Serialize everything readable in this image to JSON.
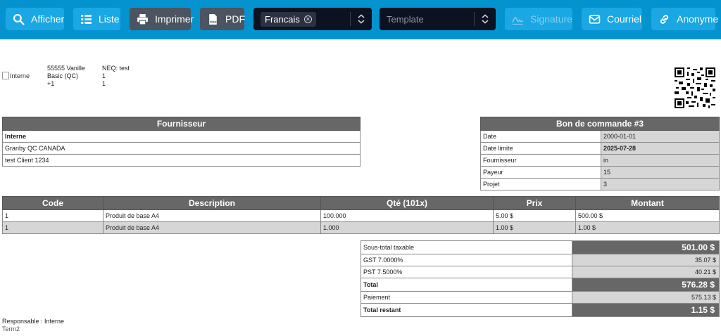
{
  "toolbar": {
    "afficher": "Afficher",
    "liste": "Liste",
    "imprimer": "Imprimer",
    "pdf": "PDF",
    "language_selected": "Francais",
    "template_placeholder": "Template",
    "signature": "Signature",
    "courriel": "Courriel",
    "anonyme": "Anonyme"
  },
  "company": {
    "logo_alt": "Interne",
    "address_line1": "55555 Vanille",
    "address_line2": "Basic (QC)",
    "address_line3": "+1",
    "neq": "NEQ: test",
    "val1": "1",
    "val2": "1"
  },
  "supplier": {
    "header": "Fournisseur",
    "name": "Interne",
    "address": "Granby QC CANADA",
    "client": "test Client 1234"
  },
  "order": {
    "header": "Bon de commande #3",
    "rows": [
      {
        "label": "Date",
        "value": "2000-01-01"
      },
      {
        "label": "Date limite",
        "value": "2025-07-28"
      },
      {
        "label": "Fournisseur",
        "value": "in"
      },
      {
        "label": "Payeur",
        "value": "15"
      },
      {
        "label": "Projet",
        "value": "3"
      }
    ]
  },
  "items": {
    "headers": {
      "code": "Code",
      "description": "Description",
      "qty": "Qté (101x)",
      "price": "Prix",
      "amount": "Montant"
    },
    "rows": [
      {
        "code": "1",
        "description": "Produit de base A4",
        "qty": "100.000",
        "price": "5.00 $",
        "amount": "500.00 $"
      },
      {
        "code": "1",
        "description": "Produit de base A4",
        "qty": "1.000",
        "price": "1.00 $",
        "amount": "1.00 $"
      }
    ]
  },
  "totals": {
    "subtotal_label": "Sous-total taxable",
    "subtotal": "501.00 $",
    "gst_label": "GST 7.0000%",
    "gst": "35.07 $",
    "pst_label": "PST 7.5000%",
    "pst": "40.21 $",
    "total_label": "Total",
    "total": "576.28 $",
    "payment_label": "Paiement",
    "payment": "575.13 $",
    "remaining_label": "Total restant",
    "remaining": "1.15 $"
  },
  "footer": {
    "responsible": "Responsable : Interne",
    "terminal": "Term2"
  }
}
